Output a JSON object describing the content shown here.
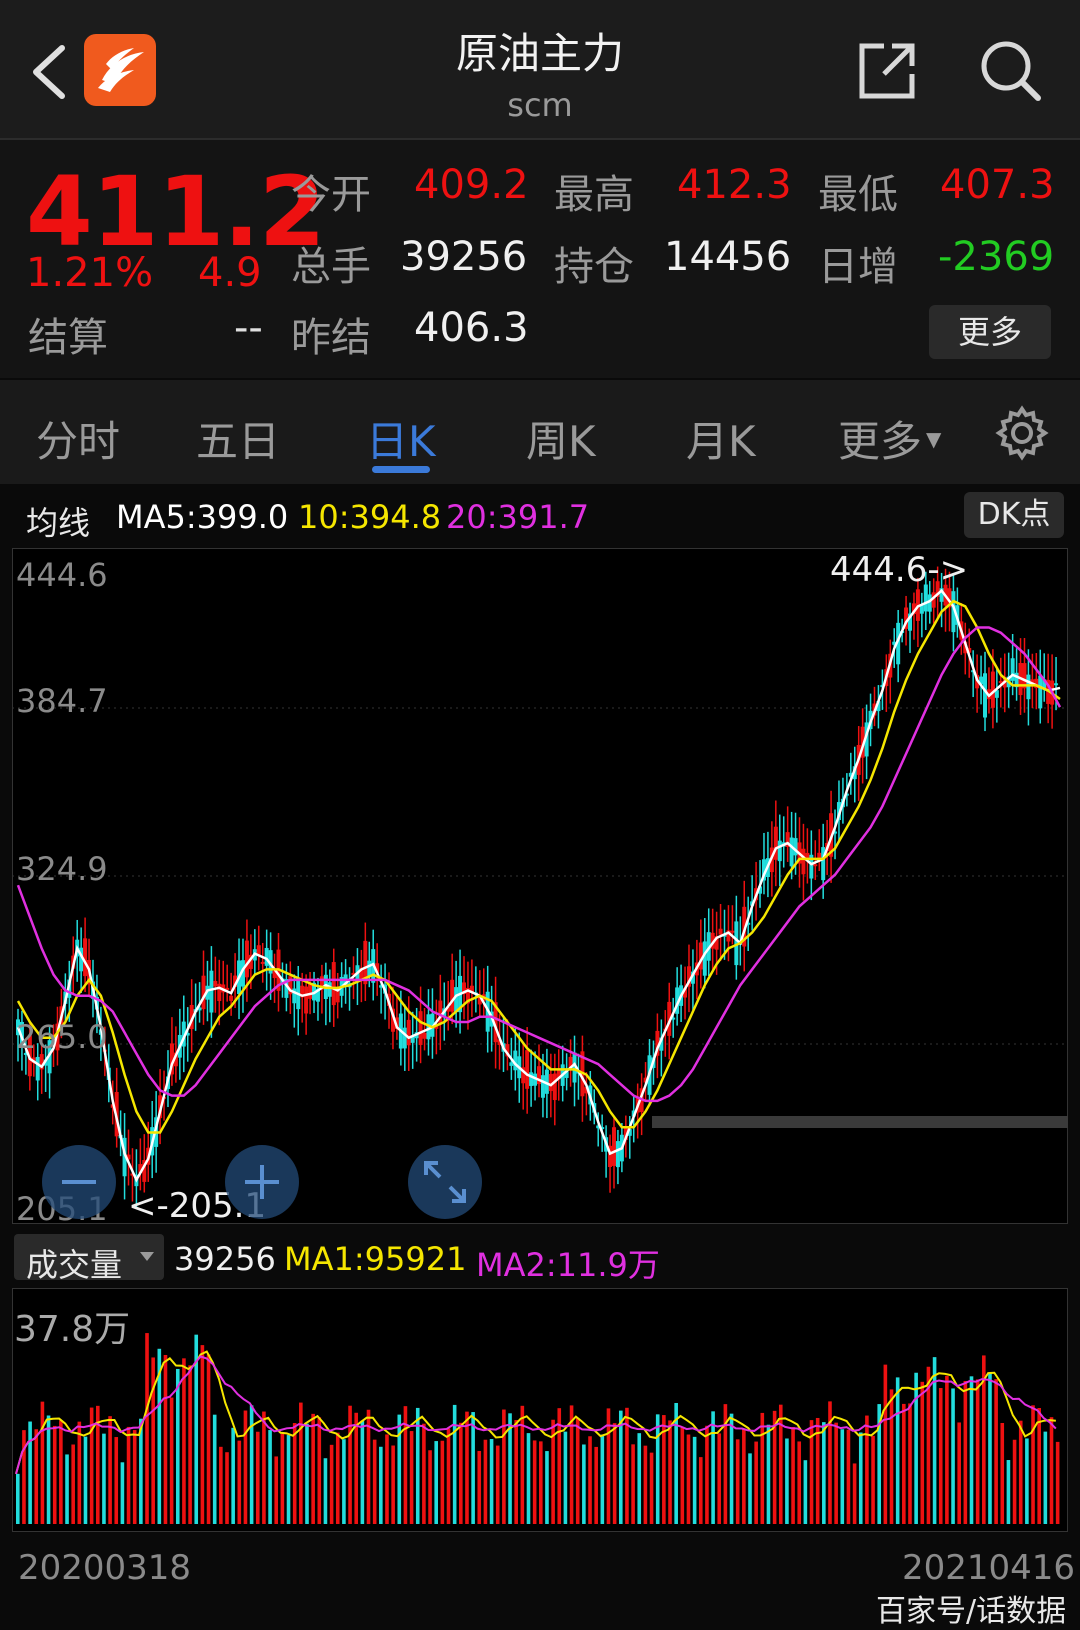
{
  "header": {
    "title": "原油主力",
    "subtitle": "scm"
  },
  "quote": {
    "price": "411.2",
    "change_pct": "1.21%",
    "change": "4.9",
    "settle_label": "结算",
    "settle_value": "--",
    "open_label": "今开",
    "open_value": "409.2",
    "high_label": "最高",
    "high_value": "412.3",
    "low_label": "最低",
    "low_value": "407.3",
    "volume_label": "总手",
    "volume_value": "39256",
    "oi_label": "持仓",
    "oi_value": "14456",
    "daily_inc_label": "日增",
    "daily_inc_value": "-2369",
    "prev_settle_label": "昨结",
    "prev_settle_value": "406.3",
    "more_label": "更多"
  },
  "tabs": [
    {
      "label": "分时",
      "active": false
    },
    {
      "label": "五日",
      "active": false
    },
    {
      "label": "日K",
      "active": true
    },
    {
      "label": "周K",
      "active": false
    },
    {
      "label": "月K",
      "active": false
    },
    {
      "label": "更多",
      "active": false
    }
  ],
  "ma": {
    "label": "均线",
    "ma5": "MA5:399.0",
    "ma10": "10:394.8",
    "ma20": "20:391.7",
    "dk_label": "DK点"
  },
  "price_chart": {
    "y_labels": [
      "444.6",
      "384.7",
      "324.9",
      "265.0",
      "205.1"
    ],
    "max_annotation": "444.6->",
    "min_annotation": "<-205.1"
  },
  "volume": {
    "selector_label": "成交量",
    "value": "39256",
    "ma1": "MA1:95921",
    "ma2": "MA2:11.9万",
    "y_label": "37.8万"
  },
  "dates": {
    "start": "20200318",
    "end": "20210416"
  },
  "watermark": "百家号/话数据",
  "colors": {
    "up": "#ee1111",
    "down": "#22dddd",
    "ma5": "#ffffff",
    "ma10": "#f5e600",
    "ma20": "#e030e0",
    "accent": "#3b7ad9"
  },
  "chart_data": {
    "type": "line",
    "ylim": [
      205.1,
      444.6
    ],
    "series": [
      {
        "name": "MA5",
        "values": [
          270,
          258,
          255,
          262,
          280,
          300,
          292,
          270,
          242,
          222,
          212,
          220,
          238,
          256,
          266,
          276,
          284,
          285,
          283,
          292,
          298,
          296,
          290,
          284,
          282,
          283,
          286,
          284,
          288,
          292,
          294,
          284,
          270,
          266,
          268,
          270,
          276,
          282,
          284,
          282,
          274,
          262,
          256,
          252,
          250,
          248,
          252,
          256,
          248,
          234,
          222,
          224,
          236,
          248,
          262,
          272,
          282,
          290,
          298,
          304,
          306,
          302,
          316,
          328,
          338,
          340,
          336,
          332,
          334,
          346,
          360,
          372,
          386,
          398,
          414,
          424,
          430,
          432,
          436,
          430,
          416,
          402,
          396,
          400,
          404,
          402,
          400,
          398,
          399
        ]
      },
      {
        "name": "MA10",
        "values": [
          280,
          272,
          266,
          266,
          272,
          282,
          288,
          282,
          268,
          252,
          238,
          230,
          230,
          238,
          248,
          258,
          266,
          274,
          278,
          284,
          290,
          292,
          292,
          290,
          288,
          286,
          285,
          285,
          286,
          288,
          290,
          288,
          282,
          276,
          272,
          270,
          272,
          276,
          280,
          282,
          280,
          274,
          268,
          262,
          258,
          254,
          254,
          254,
          252,
          246,
          238,
          232,
          232,
          238,
          246,
          256,
          266,
          276,
          286,
          294,
          300,
          302,
          306,
          312,
          320,
          328,
          334,
          334,
          334,
          338,
          346,
          354,
          364,
          376,
          390,
          402,
          412,
          420,
          428,
          432,
          430,
          422,
          412,
          404,
          400,
          400,
          400,
          398,
          394.8
        ]
      },
      {
        "name": "MA20",
        "values": [
          324,
          312,
          300,
          290,
          284,
          282,
          282,
          280,
          276,
          268,
          260,
          252,
          246,
          244,
          244,
          248,
          254,
          260,
          266,
          272,
          278,
          282,
          286,
          288,
          288,
          288,
          288,
          288,
          288,
          288,
          288,
          288,
          286,
          284,
          280,
          276,
          274,
          272,
          272,
          274,
          274,
          272,
          270,
          268,
          266,
          264,
          262,
          260,
          258,
          256,
          252,
          248,
          244,
          242,
          242,
          244,
          248,
          254,
          262,
          270,
          278,
          286,
          292,
          298,
          304,
          310,
          316,
          320,
          324,
          328,
          334,
          340,
          346,
          354,
          364,
          374,
          384,
          394,
          404,
          412,
          418,
          422,
          422,
          420,
          416,
          412,
          406,
          400,
          391.7
        ]
      }
    ],
    "volume_ylim": [
      0,
      378000
    ]
  }
}
